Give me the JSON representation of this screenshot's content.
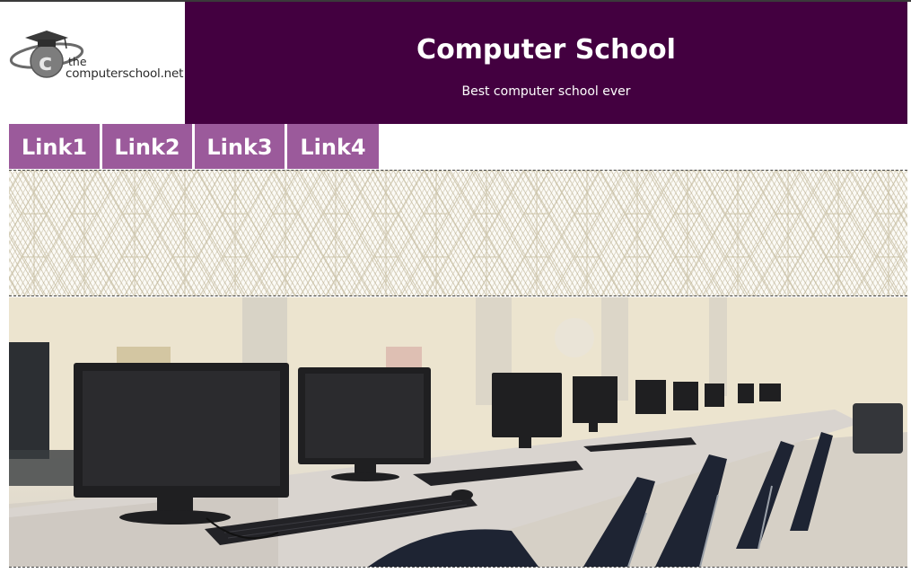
{
  "header": {
    "logo_the": "the",
    "logo_text": "computerschool.net",
    "title": "Computer School",
    "subtitle": "Best computer school ever"
  },
  "nav": {
    "items": [
      {
        "label": "Link1"
      },
      {
        "label": "Link2"
      },
      {
        "label": "Link3"
      },
      {
        "label": "Link4"
      }
    ]
  },
  "colors": {
    "header_bg": "#430040",
    "nav_bg": "#9b5a9b",
    "nav_text": "#ffffff",
    "pattern_line": "#beb496"
  },
  "icons": {
    "logo": "graduation-cap-globe-logo",
    "banner_pattern": "geometric-line-pattern",
    "hero_image": "computer-lab-photo"
  }
}
